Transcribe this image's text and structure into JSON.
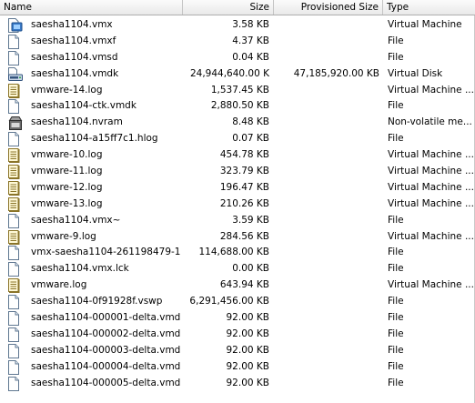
{
  "columns": {
    "name": "Name",
    "size": "Size",
    "provisioned_size": "Provisioned Size",
    "type": "Type"
  },
  "files": [
    {
      "name": "saesha1104.vmx",
      "size": "3.58 KB",
      "provisioned": "",
      "type": "Virtual Machine",
      "icon": "virtual-machine-icon"
    },
    {
      "name": "saesha1104.vmxf",
      "size": "4.37 KB",
      "provisioned": "",
      "type": "File",
      "icon": "file-icon"
    },
    {
      "name": "saesha1104.vmsd",
      "size": "0.04 KB",
      "provisioned": "",
      "type": "File",
      "icon": "file-icon"
    },
    {
      "name": "saesha1104.vmdk",
      "size": "24,944,640.00 K",
      "provisioned": "47,185,920.00 KB",
      "type": "Virtual Disk",
      "icon": "virtual-disk-icon"
    },
    {
      "name": "vmware-14.log",
      "size": "1,537.45 KB",
      "provisioned": "",
      "type": "Virtual Machine ...",
      "icon": "log-file-icon"
    },
    {
      "name": "saesha1104-ctk.vmdk",
      "size": "2,880.50 KB",
      "provisioned": "",
      "type": "File",
      "icon": "file-icon"
    },
    {
      "name": "saesha1104.nvram",
      "size": "8.48 KB",
      "provisioned": "",
      "type": "Non-volatile me...",
      "icon": "nvram-icon"
    },
    {
      "name": "saesha1104-a15ff7c1.hlog",
      "size": "0.07 KB",
      "provisioned": "",
      "type": "File",
      "icon": "file-icon"
    },
    {
      "name": "vmware-10.log",
      "size": "454.78 KB",
      "provisioned": "",
      "type": "Virtual Machine ...",
      "icon": "log-file-icon"
    },
    {
      "name": "vmware-11.log",
      "size": "323.79 KB",
      "provisioned": "",
      "type": "Virtual Machine ...",
      "icon": "log-file-icon"
    },
    {
      "name": "vmware-12.log",
      "size": "196.47 KB",
      "provisioned": "",
      "type": "Virtual Machine ...",
      "icon": "log-file-icon"
    },
    {
      "name": "vmware-13.log",
      "size": "210.26 KB",
      "provisioned": "",
      "type": "Virtual Machine ...",
      "icon": "log-file-icon"
    },
    {
      "name": "saesha1104.vmx~",
      "size": "3.59 KB",
      "provisioned": "",
      "type": "File",
      "icon": "file-icon"
    },
    {
      "name": "vmware-9.log",
      "size": "284.56 KB",
      "provisioned": "",
      "type": "Virtual Machine ...",
      "icon": "log-file-icon"
    },
    {
      "name": "vmx-saesha1104-261198479-1...",
      "size": "114,688.00 KB",
      "provisioned": "",
      "type": "File",
      "icon": "file-icon"
    },
    {
      "name": "saesha1104.vmx.lck",
      "size": "0.00 KB",
      "provisioned": "",
      "type": "File",
      "icon": "file-icon"
    },
    {
      "name": "vmware.log",
      "size": "643.94 KB",
      "provisioned": "",
      "type": "Virtual Machine ...",
      "icon": "log-file-icon"
    },
    {
      "name": "saesha1104-0f91928f.vswp",
      "size": "6,291,456.00 KB",
      "provisioned": "",
      "type": "File",
      "icon": "file-icon"
    },
    {
      "name": "saesha1104-000001-delta.vmdk",
      "size": "92.00 KB",
      "provisioned": "",
      "type": "File",
      "icon": "file-icon"
    },
    {
      "name": "saesha1104-000002-delta.vmdk",
      "size": "92.00 KB",
      "provisioned": "",
      "type": "File",
      "icon": "file-icon"
    },
    {
      "name": "saesha1104-000003-delta.vmdk",
      "size": "92.00 KB",
      "provisioned": "",
      "type": "File",
      "icon": "file-icon"
    },
    {
      "name": "saesha1104-000004-delta.vmdk",
      "size": "92.00 KB",
      "provisioned": "",
      "type": "File",
      "icon": "file-icon"
    },
    {
      "name": "saesha1104-000005-delta.vmdk",
      "size": "92.00 KB",
      "provisioned": "",
      "type": "File",
      "icon": "file-icon"
    }
  ]
}
